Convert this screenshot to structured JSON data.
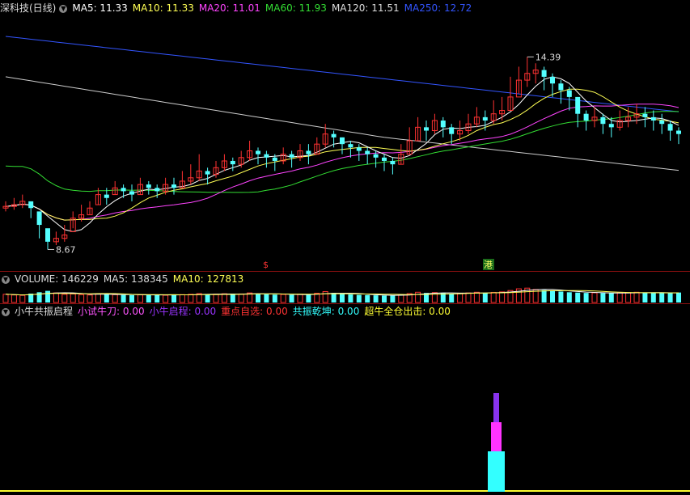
{
  "main": {
    "title": "深科技(日线)",
    "ma": [
      {
        "label": "MA5: 11.33",
        "color": "#ffffff"
      },
      {
        "label": "MA10: 11.33",
        "color": "#ffff55"
      },
      {
        "label": "MA20: 11.01",
        "color": "#ff44ff"
      },
      {
        "label": "MA60: 11.93",
        "color": "#33dd33"
      },
      {
        "label": "MA120: 11.51",
        "color": "#dddddd"
      },
      {
        "label": "MA250: 12.72",
        "color": "#3355ff"
      }
    ],
    "high_label": "14.39",
    "low_label": "8.67",
    "marker_s": "$",
    "marker_gang": "港"
  },
  "volume": {
    "title": "VOLUME: 146229",
    "ma5": "MA5: 138345",
    "ma10": "MA10: 127813"
  },
  "indicator": {
    "title": "小牛共振启程",
    "items": [
      {
        "label": "小试牛刀: 0.00",
        "color": "#ff55ff"
      },
      {
        "label": "小牛启程: 0.00",
        "color": "#9933ff"
      },
      {
        "label": "重点自选: 0.00",
        "color": "#ff3333"
      },
      {
        "label": "共振乾坤: 0.00",
        "color": "#33ffff"
      },
      {
        "label": "超牛全仓出击: 0.00",
        "color": "#ffff33"
      }
    ]
  },
  "chart_data": {
    "type": "candlestick",
    "closes": [
      9.95,
      10.0,
      10.1,
      9.9,
      9.4,
      8.9,
      9.0,
      9.1,
      9.6,
      9.7,
      9.9,
      10.3,
      10.2,
      10.5,
      10.4,
      10.3,
      10.6,
      10.5,
      10.4,
      10.6,
      10.5,
      10.7,
      10.8,
      11.0,
      10.9,
      11.1,
      11.3,
      11.2,
      11.4,
      11.6,
      11.5,
      11.4,
      11.3,
      11.5,
      11.4,
      11.6,
      11.5,
      11.8,
      12.1,
      12.0,
      11.8,
      11.7,
      11.6,
      11.5,
      11.4,
      11.3,
      11.2,
      11.5,
      11.9,
      12.3,
      12.2,
      12.5,
      12.3,
      12.1,
      12.2,
      12.4,
      12.6,
      12.5,
      12.7,
      12.8,
      13.2,
      13.7,
      13.9,
      14.0,
      13.8,
      13.6,
      13.4,
      13.2,
      12.7,
      12.5,
      12.6,
      12.4,
      12.3,
      12.5,
      12.6,
      12.7,
      12.6,
      12.5,
      12.4,
      12.2,
      12.1
    ],
    "highs": [
      10.1,
      10.2,
      10.3,
      10.1,
      9.6,
      9.2,
      9.2,
      9.4,
      9.8,
      10.0,
      10.1,
      10.5,
      10.5,
      10.7,
      10.6,
      10.6,
      10.8,
      10.7,
      10.6,
      10.8,
      10.8,
      11.0,
      11.2,
      11.5,
      11.1,
      11.3,
      11.5,
      11.4,
      11.6,
      11.9,
      11.7,
      11.6,
      11.5,
      11.7,
      11.6,
      11.8,
      11.8,
      12.0,
      12.4,
      12.2,
      12.0,
      11.9,
      11.8,
      11.7,
      11.6,
      11.5,
      11.4,
      11.8,
      12.3,
      12.6,
      12.5,
      12.7,
      12.6,
      12.4,
      12.5,
      12.7,
      12.9,
      12.8,
      13.1,
      13.2,
      13.8,
      14.1,
      14.39,
      14.2,
      14.1,
      13.9,
      13.7,
      13.5,
      13.0,
      12.8,
      12.9,
      12.7,
      12.6,
      12.8,
      12.9,
      13.0,
      12.9,
      12.8,
      12.7,
      12.5,
      12.3
    ],
    "lows": [
      9.8,
      9.85,
      9.9,
      9.6,
      9.0,
      8.67,
      8.8,
      8.9,
      9.3,
      9.5,
      9.7,
      10.0,
      10.0,
      10.3,
      10.2,
      10.1,
      10.3,
      10.3,
      10.2,
      10.3,
      10.3,
      10.5,
      10.6,
      10.7,
      10.6,
      10.8,
      11.0,
      11.0,
      11.1,
      11.3,
      11.2,
      11.1,
      11.0,
      11.2,
      11.1,
      11.3,
      11.2,
      11.5,
      11.7,
      11.7,
      11.5,
      11.4,
      11.3,
      11.2,
      11.1,
      11.0,
      10.9,
      11.2,
      11.5,
      11.9,
      11.9,
      12.1,
      12.0,
      11.8,
      11.9,
      12.1,
      12.3,
      12.2,
      12.4,
      12.5,
      12.8,
      13.3,
      13.5,
      13.6,
      13.4,
      13.2,
      13.0,
      12.8,
      12.3,
      12.2,
      12.3,
      12.1,
      12.0,
      12.2,
      12.3,
      12.4,
      12.3,
      12.2,
      12.1,
      11.9,
      11.8
    ],
    "opens": [
      9.9,
      9.95,
      10.0,
      10.1,
      9.8,
      9.3,
      8.9,
      9.0,
      9.2,
      9.6,
      9.7,
      10.0,
      10.3,
      10.3,
      10.5,
      10.4,
      10.3,
      10.6,
      10.5,
      10.4,
      10.6,
      10.5,
      10.7,
      10.8,
      11.0,
      10.9,
      11.1,
      11.3,
      11.2,
      11.4,
      11.6,
      11.5,
      11.4,
      11.3,
      11.5,
      11.4,
      11.6,
      11.5,
      11.8,
      12.1,
      12.0,
      11.8,
      11.7,
      11.6,
      11.5,
      11.4,
      11.3,
      11.2,
      11.5,
      11.9,
      12.3,
      12.2,
      12.5,
      12.3,
      12.1,
      12.2,
      12.4,
      12.6,
      12.5,
      12.7,
      12.8,
      13.2,
      13.7,
      13.9,
      14.0,
      13.8,
      13.6,
      13.4,
      13.2,
      12.7,
      12.5,
      12.6,
      12.4,
      12.3,
      12.5,
      12.6,
      12.7,
      12.6,
      12.5,
      12.4,
      12.2
    ],
    "volumes": [
      120,
      110,
      105,
      130,
      150,
      170,
      140,
      120,
      125,
      115,
      110,
      130,
      120,
      115,
      110,
      108,
      112,
      118,
      110,
      106,
      112,
      115,
      120,
      130,
      118,
      122,
      128,
      120,
      125,
      140,
      130,
      120,
      115,
      118,
      112,
      120,
      116,
      135,
      160,
      140,
      125,
      118,
      112,
      108,
      105,
      102,
      100,
      115,
      130,
      150,
      140,
      145,
      138,
      130,
      132,
      140,
      150,
      142,
      148,
      155,
      175,
      200,
      210,
      190,
      180,
      170,
      160,
      150,
      145,
      140,
      142,
      138,
      135,
      140,
      145,
      150,
      146,
      140,
      138,
      136,
      146
    ]
  }
}
